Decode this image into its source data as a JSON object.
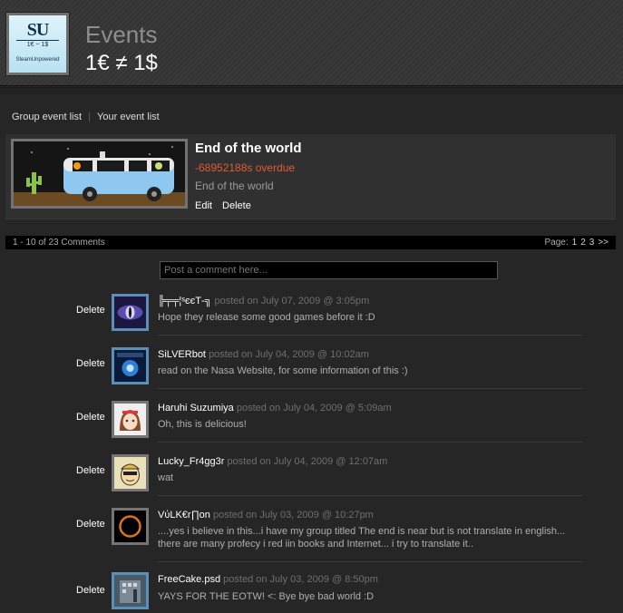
{
  "header": {
    "logo_big": "SU",
    "logo_sub": "1€ ~ 1$",
    "logo_name": "SteamUnpowered",
    "heading": "Events",
    "subheading": "1€ ≠ 1$"
  },
  "subnav": {
    "group_event_list": "Group event list",
    "your_event_list": "Your event list"
  },
  "event": {
    "title": "End of the world",
    "status": "-68952188s overdue",
    "description": "End of the world",
    "edit_label": "Edit",
    "delete_label": "Delete"
  },
  "comments_bar": {
    "count": "1 - 10 of 23 Comments",
    "page_label": "Page:",
    "pages": [
      "1",
      "2",
      "3"
    ],
    "next": ">>"
  },
  "comment_input": {
    "placeholder": "Post a comment here..."
  },
  "comments": [
    {
      "delete": "Delete",
      "author": "╠╤╤¦ˢєєΤ-╗",
      "posted": "posted on July 07, 2009 @ 3:05pm",
      "text": "Hope they release some good games before it :D",
      "avatar": "eye-avatar"
    },
    {
      "delete": "Delete",
      "author": "SiLVERbot",
      "posted": "posted on July 04, 2009 @ 10:02am",
      "text": "read on the Nasa Website, for some information of this :)",
      "avatar": "space-avatar"
    },
    {
      "delete": "Delete",
      "author": "Haruhi Suzumiya",
      "posted": "posted on July 04, 2009 @ 5:09am",
      "text": "Oh, this is delicious!",
      "avatar": "anime-avatar"
    },
    {
      "delete": "Delete",
      "author": "Lucky_Fr4gg3r",
      "posted": "posted on July 04, 2009 @ 12:07am",
      "text": "wat",
      "avatar": "vault-boy-avatar"
    },
    {
      "delete": "Delete",
      "author": "VύLK€r∏on",
      "posted": "posted on July 03, 2009 @ 10:27pm",
      "text": "....yes i believe in this...i have my group titled The end is near but is not translate in english... there are many profecy i red iin books and Internet... i try to translate it..",
      "avatar": "eclipse-avatar"
    },
    {
      "delete": "Delete",
      "author": "FreeCake.psd",
      "posted": "posted on July 03, 2009 @ 8:50pm",
      "text": "YAYS FOR THE EOTW! <: Bye bye bad world :D",
      "avatar": "building-avatar"
    }
  ],
  "colors": {
    "overdue": "#e05a36",
    "avatar_border": "#5c8fb5"
  }
}
